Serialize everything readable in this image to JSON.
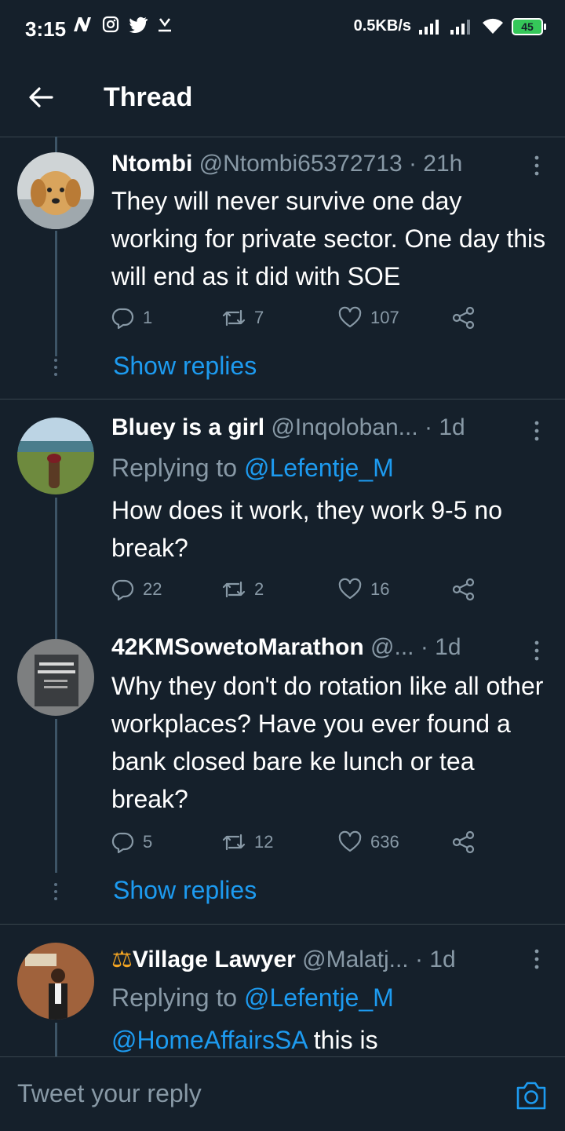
{
  "status_bar": {
    "time": "3:15",
    "net_speed": "0.5KB/s",
    "battery": "45"
  },
  "header": {
    "title": "Thread"
  },
  "tweets": [
    {
      "name": "Ntombi",
      "handle": "@Ntombi65372713",
      "time": "· 21h",
      "text": "They will never survive one day working for private sector. One day this will end as it did with SOE",
      "replies": "1",
      "retweets": "7",
      "likes": "107",
      "show_replies": "Show replies"
    },
    {
      "name": "Bluey is a girl",
      "handle": "@Inqoloban...",
      "time": "· 1d",
      "replying_prefix": "Replying to ",
      "replying_to": "@Lefentje_M",
      "text": "How does it work, they work 9-5 no break?",
      "replies": "22",
      "retweets": "2",
      "likes": "16"
    },
    {
      "name": "42KMSowetoMarathon",
      "handle": "@...",
      "time": "· 1d",
      "text": "Why they don't do rotation like all other workplaces? Have you ever found a bank closed bare ke lunch or tea break?",
      "replies": "5",
      "retweets": "12",
      "likes": "636",
      "show_replies": "Show replies"
    },
    {
      "name_prefix": "⚖",
      "name": "Village Lawyer",
      "handle": "@Malatj...",
      "time": "· 1d",
      "replying_prefix": "Replying to ",
      "replying_to": "@Lefentje_M",
      "text_mention": "@HomeAffairsSA",
      "text": " this is"
    }
  ],
  "reply_box": {
    "placeholder": "Tweet your reply"
  },
  "icons": {
    "reply": "reply-icon",
    "retweet": "retweet-icon",
    "like": "heart-icon",
    "share": "share-icon",
    "more": "more-vertical-icon",
    "camera": "camera-icon",
    "back": "arrow-left-icon"
  },
  "colors": {
    "background": "#15202b",
    "accent": "#1d9bf0",
    "secondary_text": "#8899a6",
    "divider": "#38444d"
  }
}
